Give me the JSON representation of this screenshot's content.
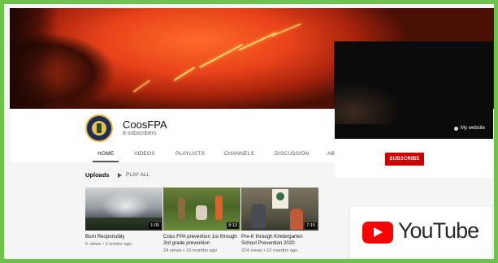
{
  "channel": {
    "name": "CoosFPA",
    "subscribers": "8 subscribers"
  },
  "tabs": [
    {
      "label": "HOME",
      "active": true
    },
    {
      "label": "VIDEOS"
    },
    {
      "label": "PLAYLISTS"
    },
    {
      "label": "CHANNELS"
    },
    {
      "label": "DISCUSSION"
    },
    {
      "label": "AB"
    }
  ],
  "overlay": {
    "link_label": "My website"
  },
  "subscribe_label": "SUBSCRIBE",
  "uploads": {
    "title": "Uploads",
    "play_all_label": "PLAY ALL",
    "play_icon": "play-icon",
    "videos": [
      {
        "title": "Burn Responsibly",
        "duration": "1:00",
        "meta": "5 views • 2 weeks ago"
      },
      {
        "title": "Coos FPA prevention 1st through 3rd grade prevention",
        "duration": "8:13",
        "meta": "24 views • 10 months ago"
      },
      {
        "title": "Pre-K through Kindergarten School Prevention 2020",
        "duration": "7:15",
        "meta": "224 views • 10 months ago"
      }
    ]
  },
  "youtube_logo": {
    "wordmark": "YouTube"
  },
  "colors": {
    "frame": "#6cc24a",
    "subscribe": "#cc0000",
    "youtube_red": "#ff0000"
  }
}
